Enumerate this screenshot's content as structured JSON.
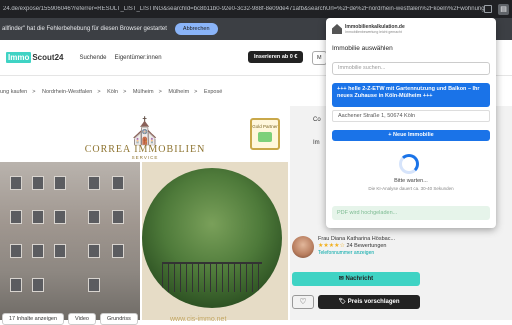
{
  "browser": {
    "url": "24.de/expose/155906046?referrer=RESULT_LIST_LISTING&searchId=bc8b11b0-92e0-3c32-988f-8e09de471afb&searchUrl=%2Fde%2Fnordrhein-westfalen%2Fkoeln%2Fwohnung-kaufen"
  },
  "banner": {
    "text": "allfinder\" hat die Fehlerbehebung für diesen Browser gestartet",
    "cancel_label": "Abbrechen"
  },
  "site": {
    "logo_immo": "Immo",
    "logo_scout": "Scout24",
    "nav": [
      "Suchende",
      "Eigentümer:innen"
    ],
    "insert_label": "Inserieren ab 0 €",
    "more_label": "M"
  },
  "breadcrumbs": [
    "ung kaufen",
    ">",
    "Nordrhein-Westfalen",
    ">",
    "Köln",
    ">",
    "Mülheim",
    ">",
    "Mülheim",
    ">",
    "Exposé"
  ],
  "listing": {
    "brand_name": "CORREA IMMOBILIEN",
    "brand_sub": "SERVICE",
    "gold_label": "Gold Partner",
    "website": "www.cis-immo.net",
    "buttons": [
      "17 Inhalte anzeigen",
      "Video",
      "Grundriss"
    ]
  },
  "rightcol": {
    "label_top": "Co",
    "label_mid": "Im"
  },
  "agent": {
    "name": "Frau Diana Katharina Hösbac...",
    "rating_stars": "★★★★☆",
    "reviews": "24 Bewertungen",
    "phone": "Telefonnummer anzeigen",
    "message_label": "Nachricht",
    "price_label": "Preis vorschlagen",
    "heart": "♡"
  },
  "popup": {
    "title": "Immobilienkalkulation.de",
    "subtitle": "Immobilienbewertung leicht gemacht",
    "section": "Immobilie auswählen",
    "search_placeholder": "Immobilie suchen...",
    "selected": "+++ helle 2-Z-ETW mit Gartennutzung und Balkon – Ihr neues Zuhause in Köln-Mülheim +++",
    "address": "Aachener Straße 1, 50674 Köln",
    "new_label": "+ Neue Immobilie",
    "wait": "Bitte warten...",
    "hint": "Die KI-Analyse dauert ca. 30-40 Sekunden",
    "pdf": "PDF wird hochgeladen..."
  }
}
